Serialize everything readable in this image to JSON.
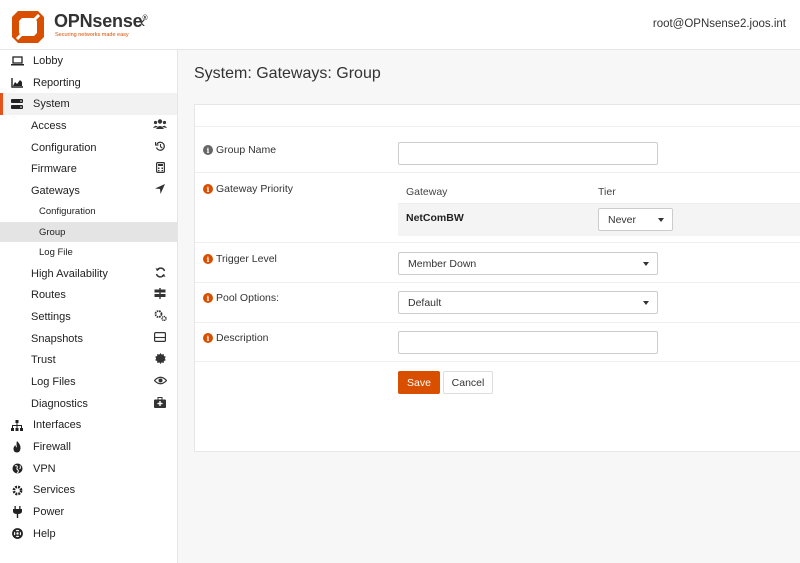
{
  "brand": {
    "name": "OPNsense",
    "trademark": "®",
    "tagline": "Securing networks made easy",
    "accent_color": "#d94f00"
  },
  "header": {
    "user": "root@OPNsense2.joos.int",
    "collapse_icon": "chevron-left-icon"
  },
  "sidebar": {
    "top_items": [
      {
        "label": "Lobby",
        "icon": "laptop-icon"
      },
      {
        "label": "Reporting",
        "icon": "area-chart-icon"
      }
    ],
    "system": {
      "label": "System",
      "icon": "server-icon",
      "items": [
        {
          "label": "Access",
          "icon": "users-icon"
        },
        {
          "label": "Configuration",
          "icon": "history-icon"
        },
        {
          "label": "Firmware",
          "icon": "calculator-icon"
        },
        {
          "label": "Gateways",
          "icon": "location-arrow-icon"
        }
      ],
      "gateway_items": [
        {
          "label": "Configuration"
        },
        {
          "label": "Group"
        },
        {
          "label": "Log File"
        }
      ],
      "items_after": [
        {
          "label": "High Availability",
          "icon": "refresh-icon"
        },
        {
          "label": "Routes",
          "icon": "map-signs-icon"
        },
        {
          "label": "Settings",
          "icon": "cogs-icon"
        },
        {
          "label": "Snapshots",
          "icon": "hdd-icon"
        },
        {
          "label": "Trust",
          "icon": "certificate-icon"
        },
        {
          "label": "Log Files",
          "icon": "eye-icon"
        },
        {
          "label": "Diagnostics",
          "icon": "medkit-icon"
        }
      ]
    },
    "bottom_items": [
      {
        "label": "Interfaces",
        "icon": "sitemap-icon"
      },
      {
        "label": "Firewall",
        "icon": "fire-icon"
      },
      {
        "label": "VPN",
        "icon": "globe-icon"
      },
      {
        "label": "Services",
        "icon": "gear-icon"
      },
      {
        "label": "Power",
        "icon": "plug-icon"
      },
      {
        "label": "Help",
        "icon": "life-ring-icon"
      }
    ]
  },
  "main": {
    "title": "System: Gateways: Group",
    "form": {
      "group_name": {
        "label": "Group Name",
        "value": ""
      },
      "gateway_priority": {
        "label": "Gateway Priority",
        "columns": [
          "Gateway",
          "Tier"
        ],
        "rows": [
          {
            "gateway": "NetComBW",
            "tier": "Never"
          }
        ]
      },
      "trigger_level": {
        "label": "Trigger Level",
        "value": "Member Down"
      },
      "pool_options": {
        "label": "Pool Options:",
        "value": "Default"
      },
      "description": {
        "label": "Description",
        "value": ""
      },
      "save_label": "Save",
      "cancel_label": "Cancel"
    }
  }
}
